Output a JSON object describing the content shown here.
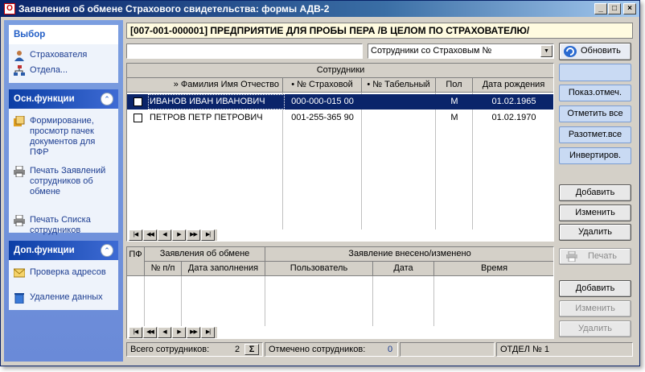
{
  "window": {
    "title": "Заявления об обмене Страхового свидетельства: формы АДВ-2",
    "app_icon": "О",
    "controls": [
      "_",
      "□",
      "×"
    ]
  },
  "sidebar": {
    "groups": [
      {
        "title": "Выбор",
        "style": "plain",
        "items": [
          {
            "label": "Страхователя",
            "icon": "person-icon"
          },
          {
            "label": "Отдела...",
            "icon": "org-structure-icon"
          }
        ]
      },
      {
        "title": "Осн.функции",
        "style": "dark",
        "collapse_glyph": "⌃",
        "items": [
          {
            "label": "Формирование, просмотр пачек документов для ПФР",
            "icon": "documents-icon"
          },
          {
            "label": "Печать Заявлений сотрудников об обмене",
            "icon": "printer-icon"
          },
          {
            "label": "Печать Списка сотрудников",
            "icon": "printer-icon"
          }
        ]
      },
      {
        "title": "Доп.функции",
        "style": "dark",
        "collapse_glyph": "⌃",
        "items": [
          {
            "label": "Проверка адресов",
            "icon": "envelope-icon"
          },
          {
            "label": "Удаление данных",
            "icon": "trash-icon"
          }
        ]
      }
    ]
  },
  "org_header": "[007-001-000001] ПРЕДПРИЯТИЕ ДЛЯ ПРОБЫ ПЕРА /В ЦЕЛОМ ПО СТРАХОВАТЕЛЮ/",
  "search": {
    "value": "",
    "placeholder": ""
  },
  "filter_combo": {
    "selected": "Сотрудники со Страховым №"
  },
  "refresh_button": "Обновить",
  "employees_grid": {
    "title": "Сотрудники",
    "columns": [
      "» Фамилия Имя Отчество",
      "• № Страховой",
      "• № Табельный",
      "Пол",
      "Дата рождения"
    ],
    "rows": [
      {
        "name": "ИВАНОВ ИВАН ИВАНОВИЧ",
        "snils": "000-000-015 00",
        "tab": "",
        "sex": "М",
        "dob": "01.02.1965",
        "selected": true
      },
      {
        "name": "ПЕТРОВ ПЕТР ПЕТРОВИЧ",
        "snils": "001-255-365 90",
        "tab": "",
        "sex": "М",
        "dob": "01.02.1970",
        "selected": false
      }
    ]
  },
  "nav_glyphs": [
    "|◀",
    "◀◀",
    "◀",
    "▶",
    "▶▶",
    "▶|"
  ],
  "right_buttons": {
    "show_marked": "Показ.отмеч.",
    "mark_all": "Отметить все",
    "unmark_all": "Разотмет.все",
    "invert": "Инвертиров.",
    "add1": "Добавить",
    "edit1": "Изменить",
    "delete1": "Удалить",
    "print": "Печать",
    "add2": "Добавить",
    "edit2": "Изменить",
    "delete2": "Удалить"
  },
  "applications_grid": {
    "col_pf": "ПФ",
    "group1": "Заявления об обмене",
    "group2": "Заявление внесено/изменено",
    "columns": [
      "№ п/п",
      "Дата заполнения",
      "Пользователь",
      "Дата",
      "Время"
    ]
  },
  "status": {
    "total_label": "Всего сотрудников:",
    "total_value": "2",
    "sum_glyph": "Σ",
    "marked_label": "Отмечено сотрудников:",
    "marked_value": "0",
    "dept": "ОТДЕЛ № 1"
  }
}
